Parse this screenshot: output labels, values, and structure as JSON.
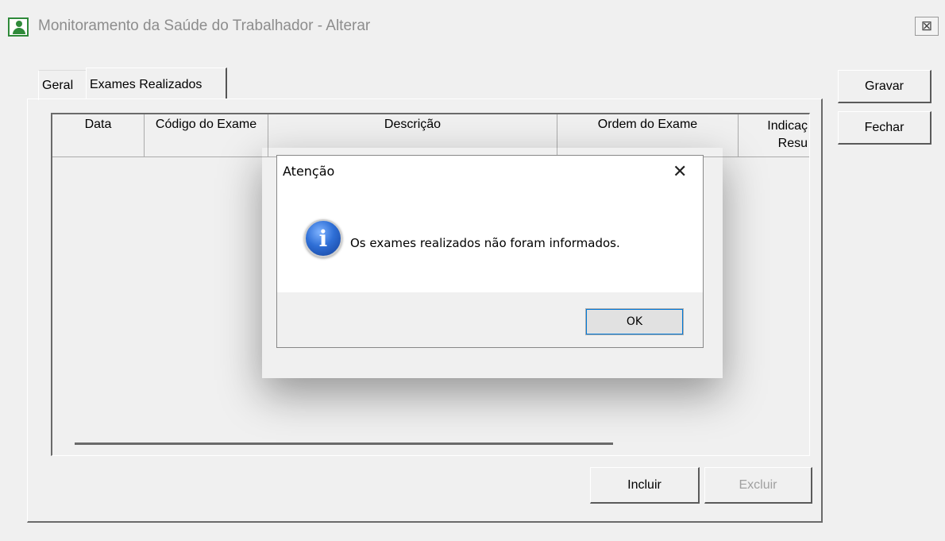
{
  "window": {
    "title": "Monitoramento da Saúde do Trabalhador - Alterar",
    "close_glyph": "⊠"
  },
  "tabs": [
    {
      "label": "Geral"
    },
    {
      "label": "Exames Realizados"
    }
  ],
  "grid": {
    "columns": [
      "Data",
      "Código do Exame",
      "Descrição",
      "Ordem do Exame",
      "Indicaç Resu"
    ],
    "rows": []
  },
  "buttons": {
    "gravar": "Gravar",
    "fechar": "Fechar",
    "incluir": "Incluir",
    "excluir": "Excluir"
  },
  "dialog": {
    "title": "Atenção",
    "close_glyph": "✕",
    "message": "Os exames realizados não foram informados.",
    "icon": "info-icon",
    "icon_glyph": "i",
    "ok_label": "OK"
  },
  "colors": {
    "app_icon": "#2f8a3a",
    "title_text": "#8d8d8d",
    "dialog_focus": "#0078d7"
  }
}
